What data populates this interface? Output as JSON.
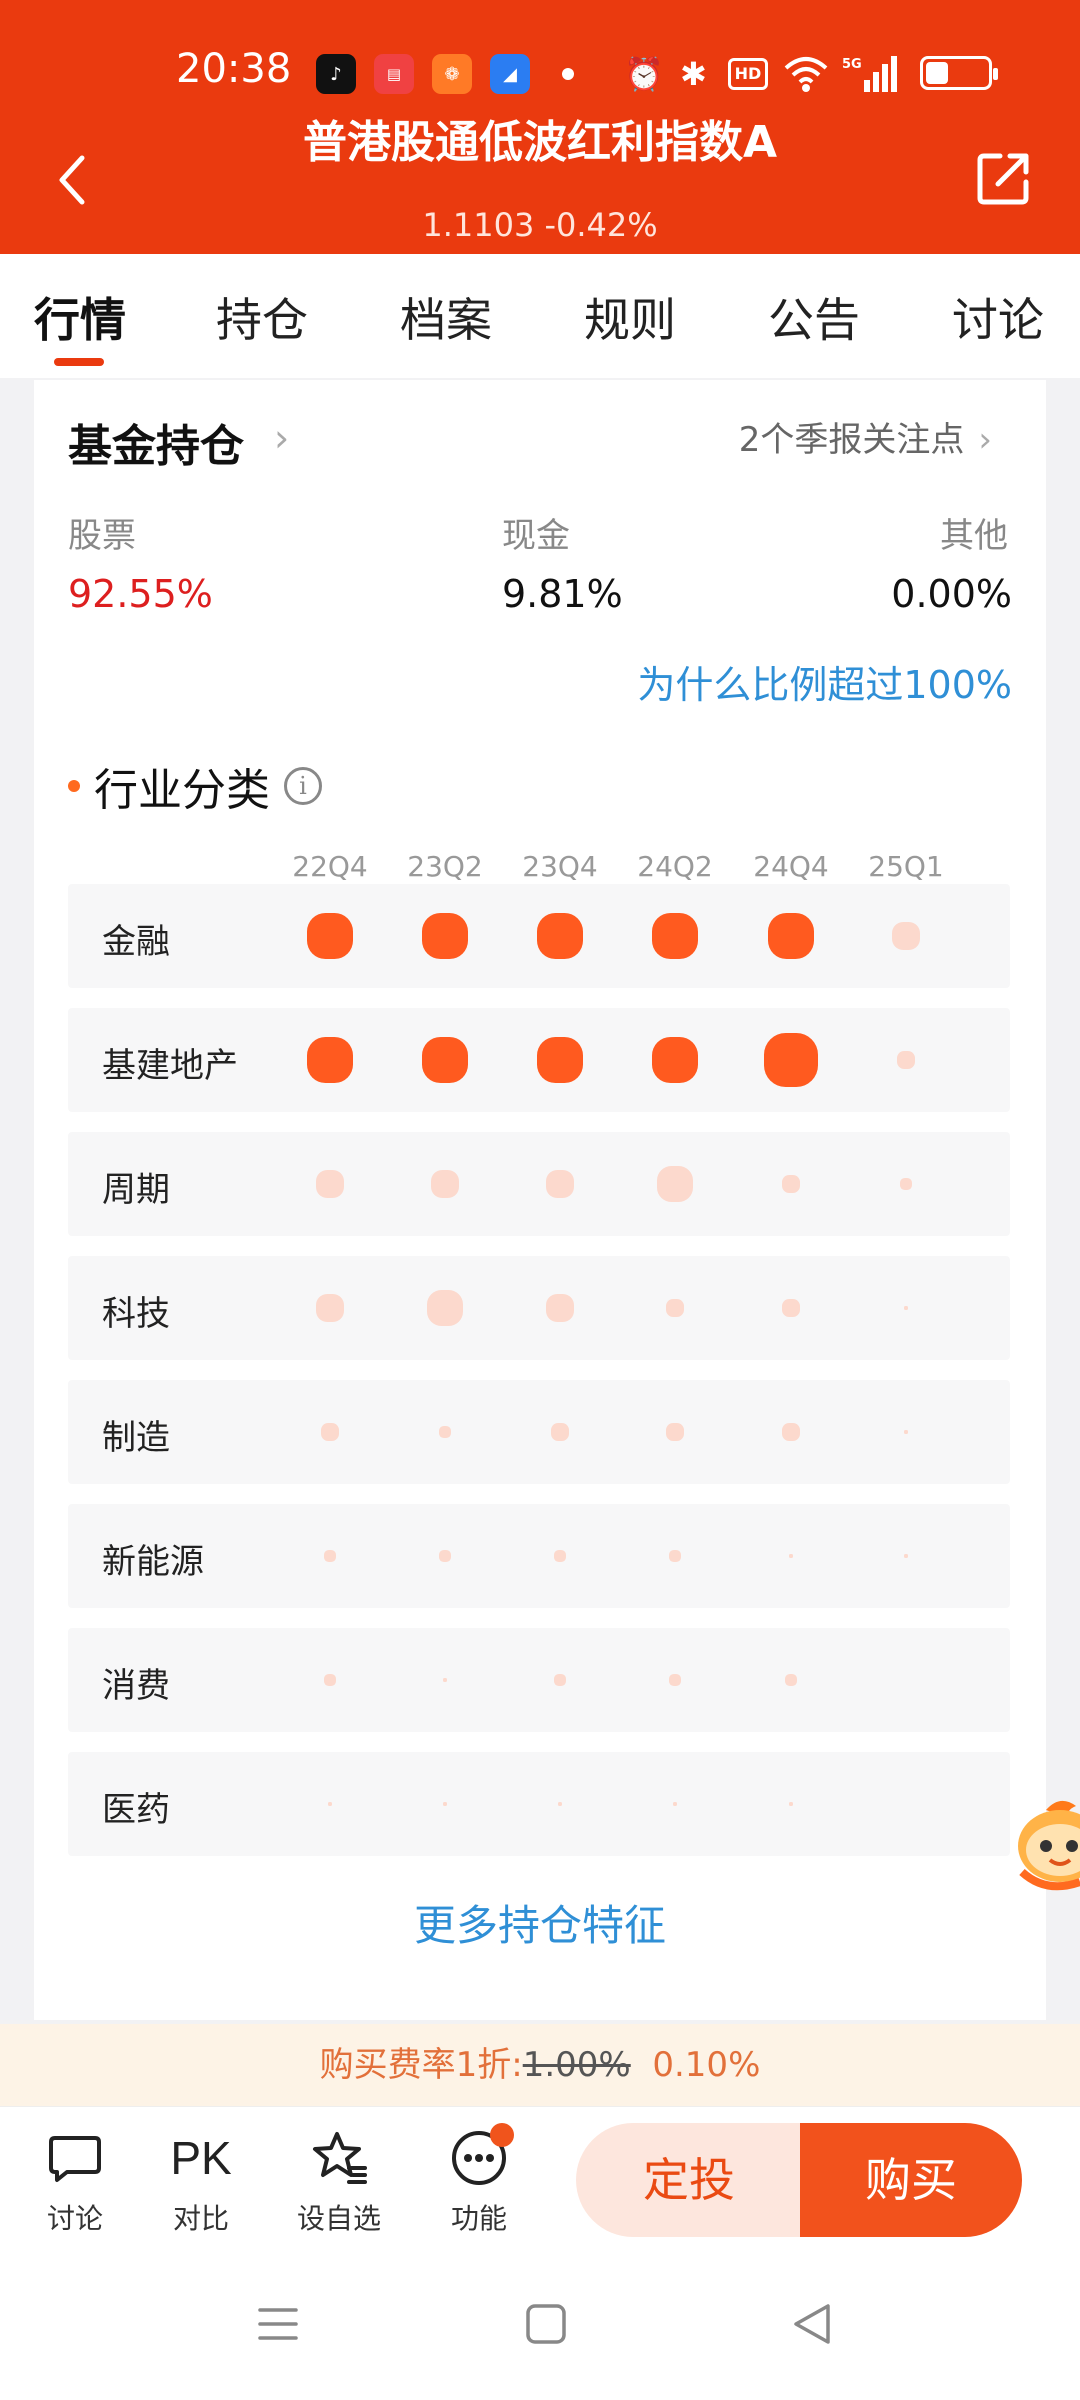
{
  "status_bar": {
    "time": "20:38"
  },
  "header": {
    "title": "普港股通低波红利指数A",
    "price_line": "1.1103 -0.42%",
    "back_icon": "chevron-left-icon",
    "share_icon": "share-icon"
  },
  "tabs": [
    {
      "label": "行情",
      "active": true
    },
    {
      "label": "持仓",
      "active": false
    },
    {
      "label": "档案",
      "active": false
    },
    {
      "label": "规则",
      "active": false
    },
    {
      "label": "公告",
      "active": false
    },
    {
      "label": "讨论",
      "active": false
    }
  ],
  "holdings": {
    "title": "基金持仓",
    "attention_link": "2个季报关注点",
    "allocation": [
      {
        "label": "股票",
        "value": "92.55%"
      },
      {
        "label": "现金",
        "value": "9.81%"
      },
      {
        "label": "其他",
        "value": "0.00%"
      }
    ],
    "why_link": "为什么比例超过100%",
    "industry_title": "行业分类",
    "quarters": [
      "22Q4",
      "23Q2",
      "23Q4",
      "24Q2",
      "24Q4",
      "25Q1"
    ],
    "industries": [
      {
        "name": "金融",
        "levels": [
          5,
          5,
          5,
          5,
          5,
          3
        ]
      },
      {
        "name": "基建地产",
        "levels": [
          5,
          5,
          5,
          5,
          6,
          2
        ]
      },
      {
        "name": "周期",
        "levels": [
          3,
          3,
          3,
          4,
          2,
          1.5
        ]
      },
      {
        "name": "科技",
        "levels": [
          3,
          4,
          3,
          2,
          2,
          0.5
        ]
      },
      {
        "name": "制造",
        "levels": [
          2,
          1.5,
          2,
          2,
          2,
          0.5
        ]
      },
      {
        "name": "新能源",
        "levels": [
          1.5,
          1.5,
          1.5,
          1.5,
          0.5,
          0.5
        ]
      },
      {
        "name": "消费",
        "levels": [
          1.5,
          0.5,
          1.5,
          1.5,
          1.5,
          0
        ]
      },
      {
        "name": "医药",
        "levels": [
          0.5,
          0.5,
          0.5,
          0.5,
          0.5,
          0
        ]
      }
    ],
    "more_link": "更多持仓特征"
  },
  "colors": {
    "brand": "#ea3a0f",
    "bubble_strong": "#ff5a1f",
    "bubble_weak": "#fcd9cd",
    "link": "#2f8fd6"
  },
  "fee_bar": {
    "prefix": "购买费率1折:",
    "old": "1.00%",
    "new": "0.10%"
  },
  "actions": [
    {
      "label": "讨论",
      "icon": "chat-bubble-icon"
    },
    {
      "label": "对比",
      "icon": "pk-icon",
      "text": "PK"
    },
    {
      "label": "设自选",
      "icon": "star-list-icon"
    },
    {
      "label": "功能",
      "icon": "more-dots-icon"
    }
  ],
  "buttons": {
    "dingtou": "定投",
    "buy": "购买"
  }
}
